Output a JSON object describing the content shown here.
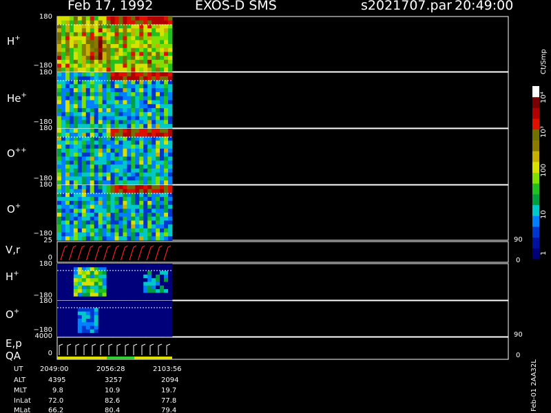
{
  "header": {
    "date": "Feb 17, 1992",
    "instrument": "EXOS-D SMS",
    "file": "s2021707.par",
    "time": "20:49:00"
  },
  "panels": [
    {
      "label": "H",
      "charge": "+",
      "ymax": "180",
      "ymin": "−180"
    },
    {
      "label": "He",
      "charge": "+",
      "ymax": "180",
      "ymin": "−180"
    },
    {
      "label": "O",
      "charge": "++",
      "ymax": "180",
      "ymin": "−180"
    },
    {
      "label": "O",
      "charge": "+",
      "ymax": "180",
      "ymin": "−180"
    },
    {
      "label": "V,r",
      "charge": "",
      "ymax": "25",
      "ymin": "0",
      "rmax": "90",
      "rmin": "0"
    },
    {
      "label": "H",
      "charge": "+",
      "ymax": "180",
      "ymin": "−180"
    },
    {
      "label": "O",
      "charge": "+",
      "ymax": "180",
      "ymin": "−180"
    },
    {
      "label": "E,p",
      "label2": "QA",
      "charge": "",
      "ymax": "4000",
      "ymin": "0",
      "rmax": "90",
      "rmin": "0"
    }
  ],
  "colorbar": {
    "title": "Ct/Smp",
    "ticks": [
      "1",
      "10",
      "100",
      "10³",
      "10⁴"
    ],
    "colors": [
      "#00007a",
      "#0010a0",
      "#0036d0",
      "#0080ff",
      "#00c8c8",
      "#00a040",
      "#20c020",
      "#80e000",
      "#d8e000",
      "#c8b000",
      "#8a7a00",
      "#707000",
      "#e01000",
      "#b00000",
      "#780000",
      "#ffffff"
    ]
  },
  "footer": {
    "rows": [
      {
        "name": "UT",
        "values": [
          "2049:00",
          "2056:28",
          "2103:56"
        ]
      },
      {
        "name": "ALT",
        "values": [
          "4395",
          "3257",
          "2094"
        ]
      },
      {
        "name": "MLT",
        "values": [
          "9.8",
          "10.9",
          "19.7"
        ]
      },
      {
        "name": "InLat",
        "values": [
          "72.0",
          "82.6",
          "77.8"
        ]
      },
      {
        "name": "MLat",
        "values": [
          "66.2",
          "80.4",
          "79.4"
        ]
      }
    ],
    "code": "Feb-01 2AA32L"
  },
  "chart_data": {
    "type": "heatmap",
    "title": "Feb 17, 1992   EXOS-D SMS",
    "x": [
      "2049:00",
      "2056:28",
      "2103:56"
    ],
    "ylim": [
      -180,
      180
    ],
    "series": [
      {
        "name": "H+",
        "ylim": [
          -180,
          180
        ]
      },
      {
        "name": "He+",
        "ylim": [
          -180,
          180
        ]
      },
      {
        "name": "O++",
        "ylim": [
          -180,
          180
        ]
      },
      {
        "name": "O+",
        "ylim": [
          -180,
          180
        ]
      },
      {
        "name": "V,r",
        "ylim": [
          0,
          25
        ]
      },
      {
        "name": "H+",
        "ylim": [
          -180,
          180
        ]
      },
      {
        "name": "O+",
        "ylim": [
          -180,
          180
        ]
      },
      {
        "name": "E,p",
        "ylim": [
          0,
          4000
        ]
      }
    ],
    "colorscale": {
      "label": "Ct/Smp",
      "type": "log",
      "range": [
        1,
        10000
      ]
    }
  }
}
